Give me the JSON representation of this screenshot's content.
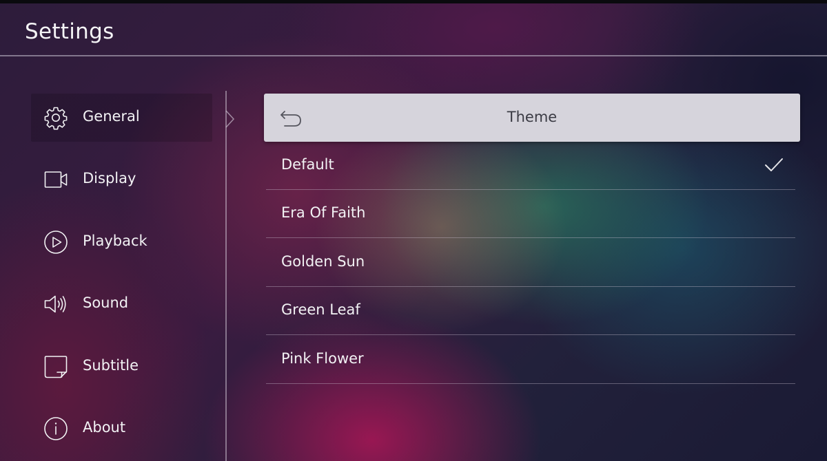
{
  "header": {
    "title": "Settings"
  },
  "sidebar": {
    "items": [
      {
        "label": "General",
        "icon": "gear-icon",
        "active": true
      },
      {
        "label": "Display",
        "icon": "camera-icon",
        "active": false
      },
      {
        "label": "Playback",
        "icon": "play-circle-icon",
        "active": false
      },
      {
        "label": "Sound",
        "icon": "speaker-icon",
        "active": false
      },
      {
        "label": "Subtitle",
        "icon": "subtitle-icon",
        "active": false
      },
      {
        "label": "About",
        "icon": "info-icon",
        "active": false
      }
    ]
  },
  "panel": {
    "title": "Theme",
    "back_icon": "back-arrow-icon",
    "options": [
      {
        "label": "Default",
        "selected": true
      },
      {
        "label": "Era Of Faith",
        "selected": false
      },
      {
        "label": "Golden Sun",
        "selected": false
      },
      {
        "label": "Green Leaf",
        "selected": false
      },
      {
        "label": "Pink Flower",
        "selected": false
      }
    ],
    "selected_icon": "check-icon"
  },
  "colors": {
    "header_bar": "#d6d4dc",
    "header_text": "#3b3b44",
    "text": "#f2f2f4"
  }
}
